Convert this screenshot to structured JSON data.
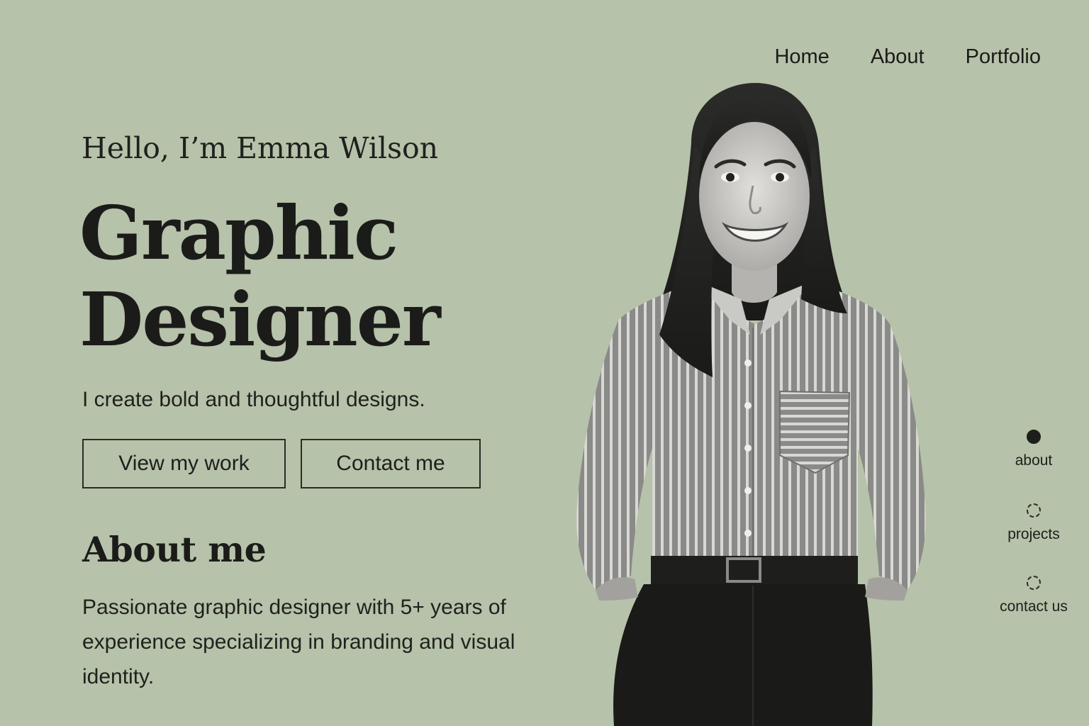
{
  "nav": {
    "home": "Home",
    "about": "About",
    "portfolio": "Portfolio"
  },
  "hero": {
    "greeting": "Hello, I’m Emma Wilson",
    "title_line1": "Graphic",
    "title_line2": "Designer",
    "tagline": "I create bold and thoughtful designs."
  },
  "buttons": {
    "view_work": "View my work",
    "contact": "Contact me"
  },
  "about": {
    "heading": "About me",
    "body": "Passionate graphic designer with 5+ years of experience specializing in branding and visual identity."
  },
  "side_nav": {
    "items": [
      {
        "label": "about",
        "active": true
      },
      {
        "label": "projects",
        "active": false
      },
      {
        "label": "contact us",
        "active": false
      }
    ]
  },
  "colors": {
    "background": "#b6c2a9",
    "text": "#1d1f1c"
  }
}
